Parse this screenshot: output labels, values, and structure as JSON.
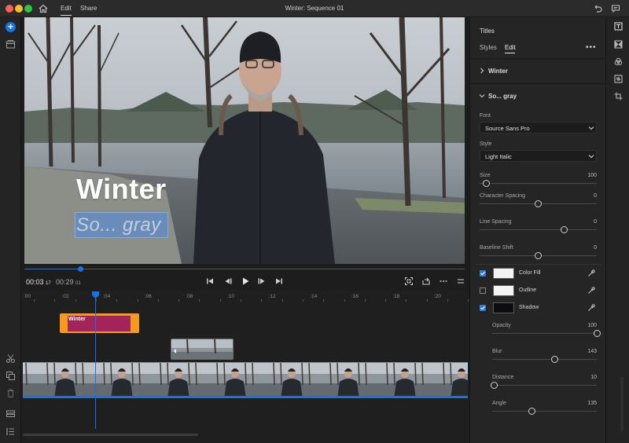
{
  "window": {
    "title": "Winter: Sequence 01",
    "tabs": [
      "Edit",
      "Share"
    ],
    "active_tab": "Edit"
  },
  "viewer": {
    "title_text": "Winter",
    "subtitle_text": "So... gray"
  },
  "transport": {
    "current_time": "00:03",
    "current_frames": "17",
    "duration_time": "00:29",
    "duration_frames": "01",
    "playhead_progress": 0.13
  },
  "timeline": {
    "ruler": [
      ":00",
      ":02",
      ":04",
      ":06",
      ":08",
      ":10",
      ":12",
      ":14",
      ":16",
      ":18",
      ":20"
    ],
    "title_clip_label": "Winter"
  },
  "panel": {
    "header": "Titles",
    "tabs": [
      "Styles",
      "Edit"
    ],
    "active_tab": "Edit",
    "sections": {
      "winter": "Winter",
      "subtitle": "So... gray"
    },
    "font_label": "Font",
    "font_value": "Source Sans Pro",
    "style_label": "Style",
    "style_value": "Light Italic",
    "sliders": [
      {
        "label": "Size",
        "value": "100",
        "fraction": 0.06
      },
      {
        "label": "Character Spacing",
        "value": "0",
        "fraction": 0.5
      },
      {
        "label": "Line Spacing",
        "value": "0",
        "fraction": 0.72
      },
      {
        "label": "Baseline Shift",
        "value": "0",
        "fraction": 0.5
      }
    ],
    "appearance": [
      {
        "label": "Color Fill",
        "checked": true,
        "color": "#f4f4f4"
      },
      {
        "label": "Outline",
        "checked": false,
        "color": "#f4f4f4"
      },
      {
        "label": "Shadow",
        "checked": true,
        "color": "#0d0d0f"
      }
    ],
    "shadow_sliders": [
      {
        "label": "Opacity",
        "value": "100",
        "fraction": 1.0
      },
      {
        "label": "Blur",
        "value": "143",
        "fraction": 0.6
      },
      {
        "label": "Distance",
        "value": "10",
        "fraction": 0.02
      },
      {
        "label": "Angle",
        "value": "135",
        "fraction": 0.38
      }
    ]
  },
  "colors": {
    "accent": "#1473e6",
    "title_clip": "#f39a1f",
    "title_clip_inner": "#a3245a"
  }
}
